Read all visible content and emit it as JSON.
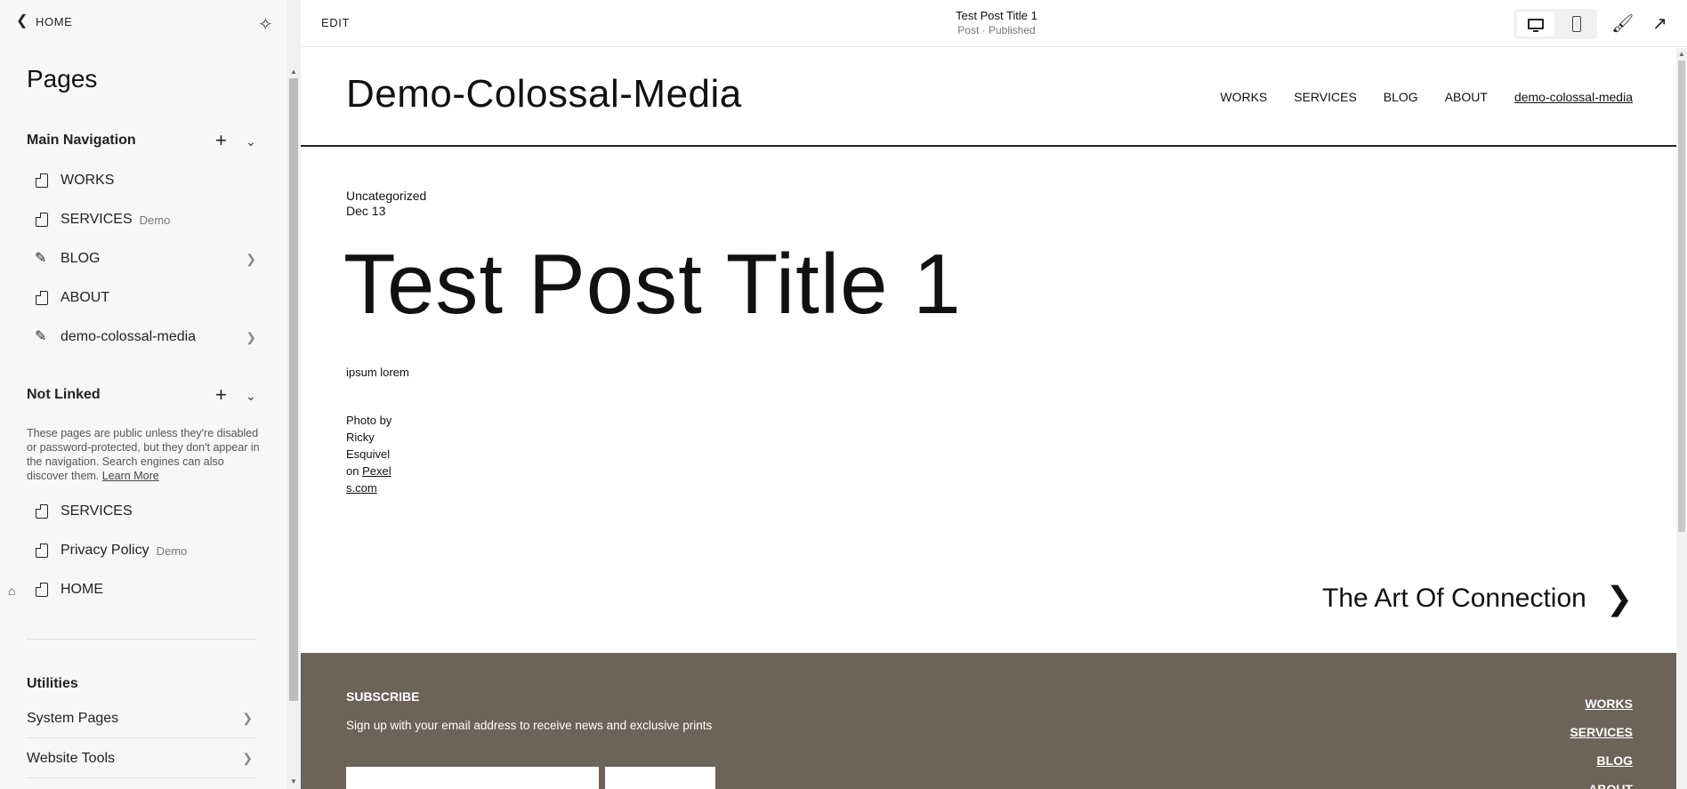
{
  "sidebar": {
    "back_label": "HOME",
    "title": "Pages",
    "main_nav": {
      "heading": "Main Navigation",
      "items": [
        {
          "label": "WORKS",
          "tag": "",
          "icon": "page-icon"
        },
        {
          "label": "SERVICES",
          "tag": "Demo",
          "icon": "page-icon"
        },
        {
          "label": "BLOG",
          "tag": "",
          "icon": "blog-icon"
        },
        {
          "label": "ABOUT",
          "tag": "",
          "icon": "page-icon"
        },
        {
          "label": "demo-colossal-media",
          "tag": "",
          "icon": "blog-icon"
        }
      ]
    },
    "not_linked": {
      "heading": "Not Linked",
      "note": "These pages are public unless they're disabled or password-protected, but they don't appear in the navigation. Search engines can also discover them.",
      "learn_more": "Learn More",
      "items": [
        {
          "label": "SERVICES",
          "tag": ""
        },
        {
          "label": "Privacy Policy",
          "tag": "Demo"
        },
        {
          "label": "HOME",
          "tag": ""
        }
      ]
    },
    "utilities": {
      "heading": "Utilities",
      "items": [
        {
          "label": "System Pages"
        },
        {
          "label": "Website Tools"
        }
      ]
    }
  },
  "topbar": {
    "edit_label": "EDIT",
    "post_title": "Test Post Title 1",
    "post_status": "Post · Published"
  },
  "site": {
    "title": "Demo-Colossal-Media",
    "nav": [
      "WORKS",
      "SERVICES",
      "BLOG",
      "ABOUT",
      "demo-colossal-media"
    ],
    "post": {
      "category": "Uncategorized",
      "date": "Dec 13",
      "title": "Test Post Title 1",
      "body": "ipsum lorem",
      "credit_prefix": "Photo by Ricky Esquivel on",
      "credit_link": "Pexels.com"
    },
    "next_post": "The Art Of Connection",
    "footer": {
      "subscribe_title": "SUBSCRIBE",
      "subscribe_text": "Sign up with your email address to receive news and exclusive prints",
      "nav": [
        "WORKS",
        "SERVICES",
        "BLOG",
        "ABOUT"
      ]
    }
  },
  "colors": {
    "sidebar_bg": "#f7f7f7",
    "footer_bg": "#6c6359",
    "text": "#111111"
  }
}
